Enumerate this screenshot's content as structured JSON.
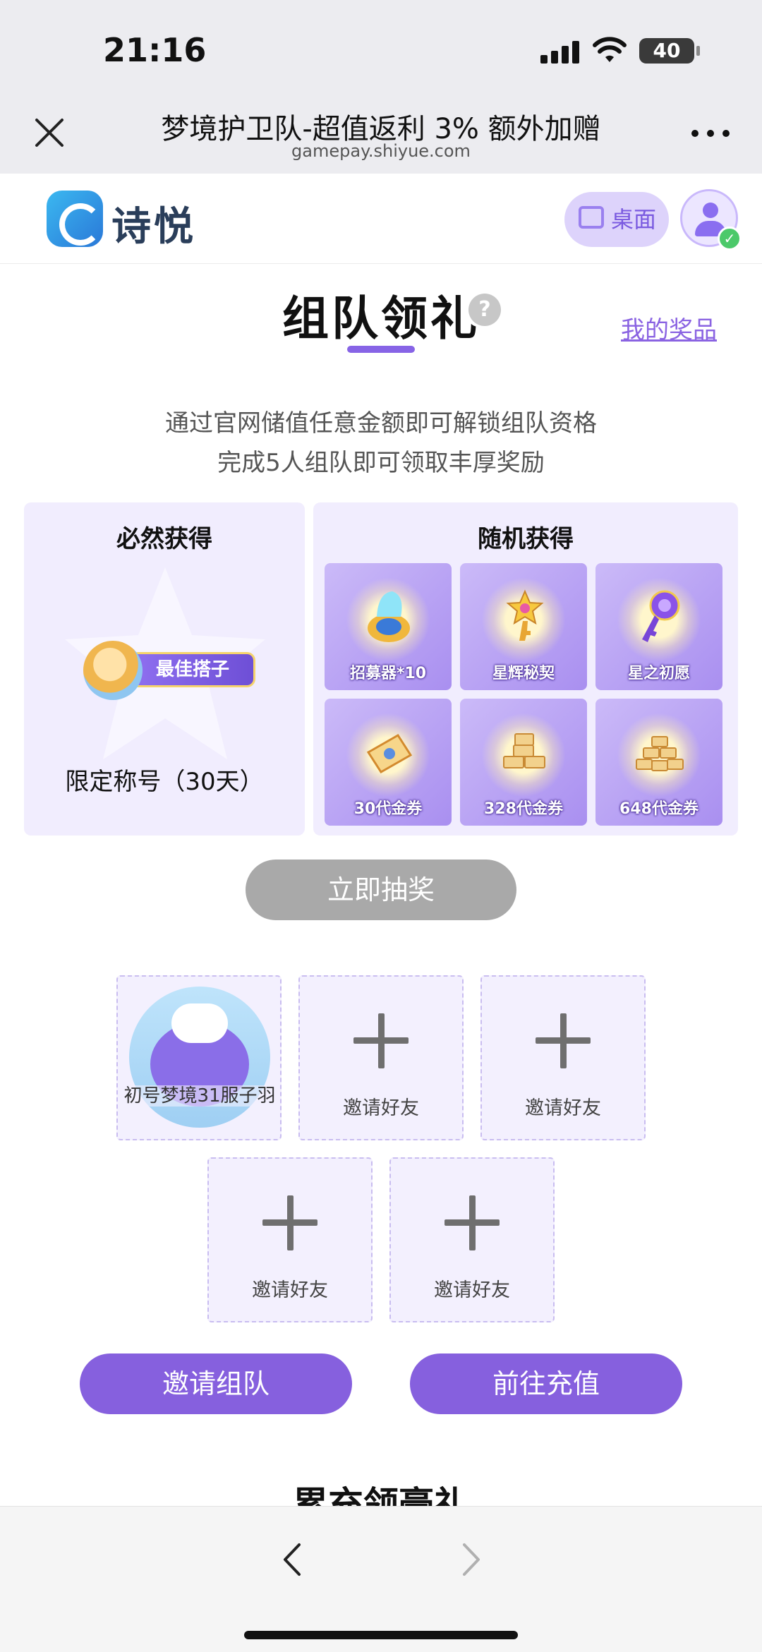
{
  "status_bar": {
    "time": "21:16",
    "battery": "40"
  },
  "webview": {
    "title": "梦境护卫队-超值返利 3% 额外加赠",
    "url": "gamepay.shiyue.com"
  },
  "site_header": {
    "logo_text": "诗悦",
    "desktop_label": "桌面"
  },
  "section": {
    "title": "组队领礼",
    "help_symbol": "?",
    "my_prizes": "我的奖品",
    "desc_line1": "通过官网储值任意金额即可解锁组队资格",
    "desc_line2": "完成5人组队即可领取丰厚奖励"
  },
  "guaranteed": {
    "title": "必然获得",
    "badge_text": "最佳搭子",
    "item_name": "限定称号（30天）"
  },
  "random": {
    "title": "随机获得",
    "items": [
      {
        "label": "招募器*10",
        "icon": "recruiter-icon"
      },
      {
        "label": "星辉秘契",
        "icon": "star-key-icon"
      },
      {
        "label": "星之初愿",
        "icon": "purple-key-icon"
      },
      {
        "label": "30代金券",
        "icon": "voucher-icon"
      },
      {
        "label": "328代金券",
        "icon": "voucher-stack-icon"
      },
      {
        "label": "648代金券",
        "icon": "voucher-pile-icon"
      }
    ]
  },
  "draw_button": "立即抽奖",
  "team": {
    "member_name": "初号梦境31服子羽",
    "invite_label": "邀请好友"
  },
  "buttons": {
    "invite_team": "邀请组队",
    "go_recharge": "前往充值"
  },
  "next_section_title": "累充领豪礼",
  "colors": {
    "accent": "#8660de",
    "panel": "#f1edfe",
    "disabled": "#a9a9a9"
  }
}
